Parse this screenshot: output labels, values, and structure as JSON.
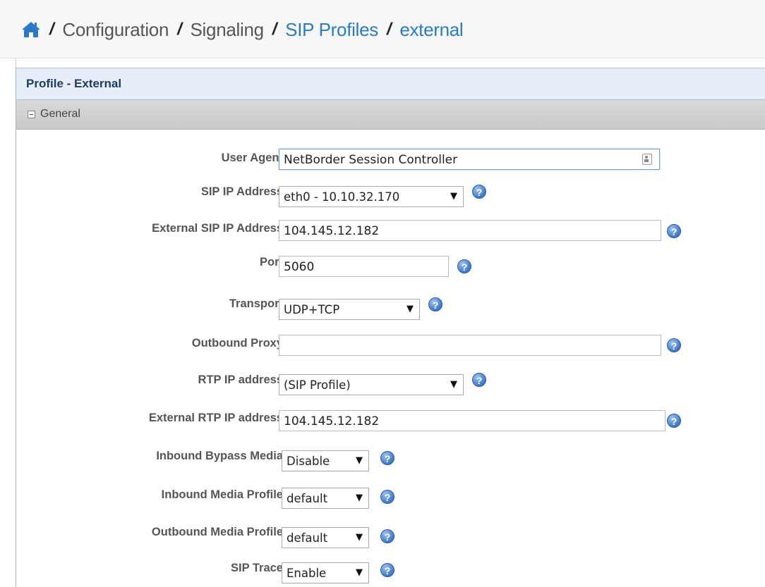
{
  "breadcrumb": {
    "home_icon": "home-icon",
    "items": [
      {
        "label": "Configuration",
        "link": false
      },
      {
        "label": "Signaling",
        "link": false
      },
      {
        "label": "SIP Profiles",
        "link": true
      },
      {
        "label": "external",
        "link": true
      }
    ],
    "separator": "/"
  },
  "panel": {
    "title": "Profile - External",
    "section": "General"
  },
  "fields": {
    "user_agent": {
      "label": "User Agent",
      "value": "NetBorder Session Controller"
    },
    "sip_ip": {
      "label": "SIP IP Address",
      "value": "eth0 - 10.10.32.170"
    },
    "ext_sip_ip": {
      "label": "External SIP IP Address",
      "value": "104.145.12.182"
    },
    "port": {
      "label": "Port",
      "value": "5060"
    },
    "transport": {
      "label": "Transport",
      "value": "UDP+TCP"
    },
    "outbound_proxy": {
      "label": "Outbound Proxy",
      "value": ""
    },
    "rtp_ip": {
      "label": "RTP IP address",
      "value": "(SIP Profile)"
    },
    "ext_rtp_ip": {
      "label": "External RTP IP address",
      "value": "104.145.12.182"
    },
    "inbound_bypass": {
      "label": "Inbound Bypass Media",
      "value": "Disable"
    },
    "inbound_media_profile": {
      "label": "Inbound Media Profile",
      "value": "default"
    },
    "outbound_media_profile": {
      "label": "Outbound Media Profile",
      "value": "default"
    },
    "sip_trace": {
      "label": "SIP Trace",
      "value": "Enable"
    }
  },
  "help_glyph": "?",
  "dropdown_arrow": "▼",
  "colors": {
    "link": "#2a7bc4",
    "panel_header_bg": "#e6eef9",
    "section_bg": "#cccccc",
    "help_icon": "#3e78c6"
  }
}
